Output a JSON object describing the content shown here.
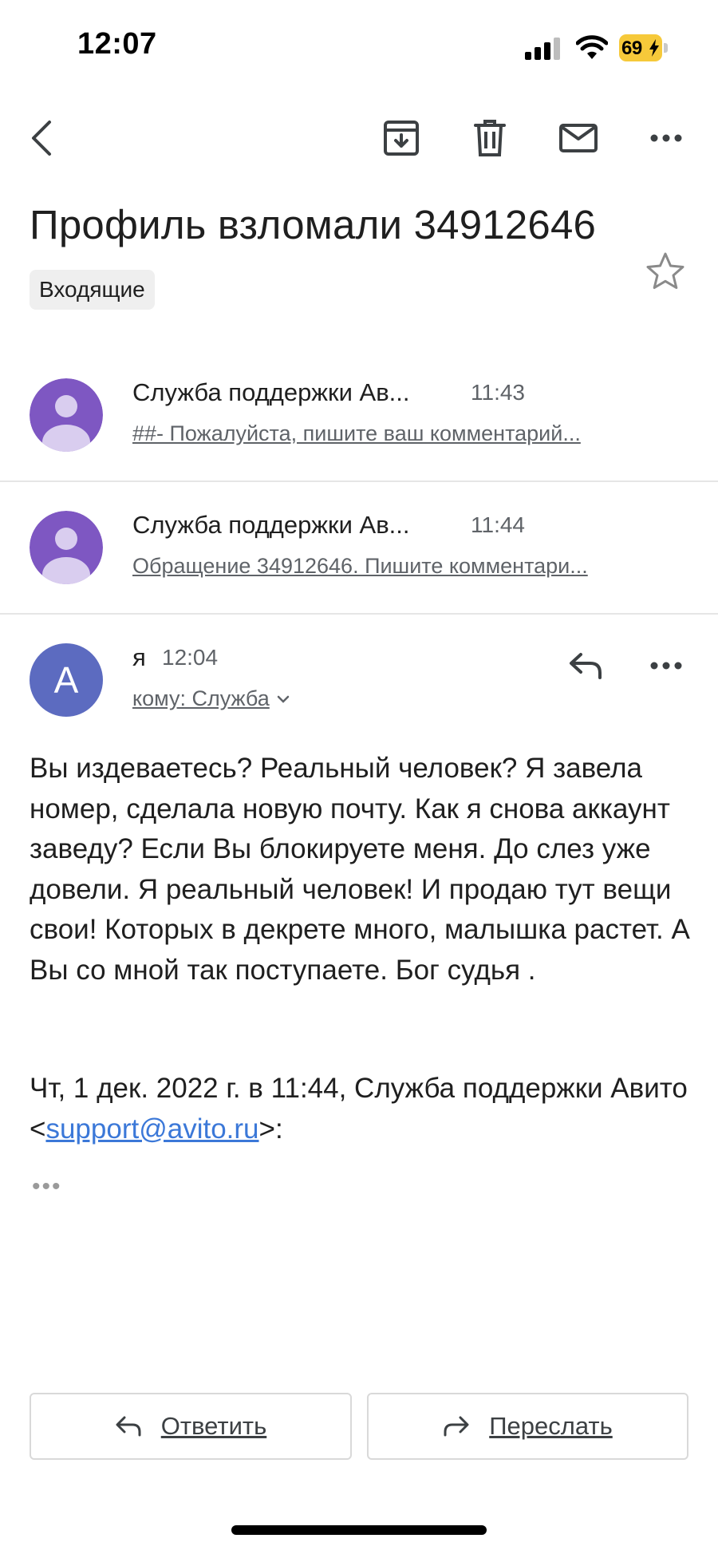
{
  "status_bar": {
    "time": "12:07",
    "battery": "69"
  },
  "email": {
    "subject": "Профиль взломали 34912646",
    "label": "Входящие"
  },
  "thread": [
    {
      "sender": "Служба поддержки Ав...",
      "time": "11:43",
      "snippet": "##- Пожалуйста, пишите ваш комментарий..."
    },
    {
      "sender": "Служба поддержки Ав...",
      "time": "11:44",
      "snippet": "Обращение 34912646. Пишите комментари..."
    }
  ],
  "open_message": {
    "avatar_letter": "A",
    "sender": "я",
    "time": "12:04",
    "recipient": "кому: Служба",
    "body": "Вы издеваетесь? Реальный человек? Я завела номер, сделала новую почту. Как я снова аккаунт заведу? Если Вы блокируете меня. До слез уже довели. Я реальный человек! И продаю тут вещи свои! Которых в декрете много, малышка растет. А Вы со мной так поступаете. Бог судья .",
    "quote_prefix": "Чт, 1 дек. 2022 г. в 11:44, Служба поддержки Авито <",
    "quote_email": "support@avito.ru",
    "quote_suffix": ">:",
    "more_dots": "•••"
  },
  "actions": {
    "reply": "Ответить",
    "forward": "Переслать"
  },
  "colors": {
    "avatar_purple": "#7e57c2",
    "avatar_blue": "#5c6bc0",
    "link": "#3b78d8",
    "battery": "#f6c93a"
  }
}
